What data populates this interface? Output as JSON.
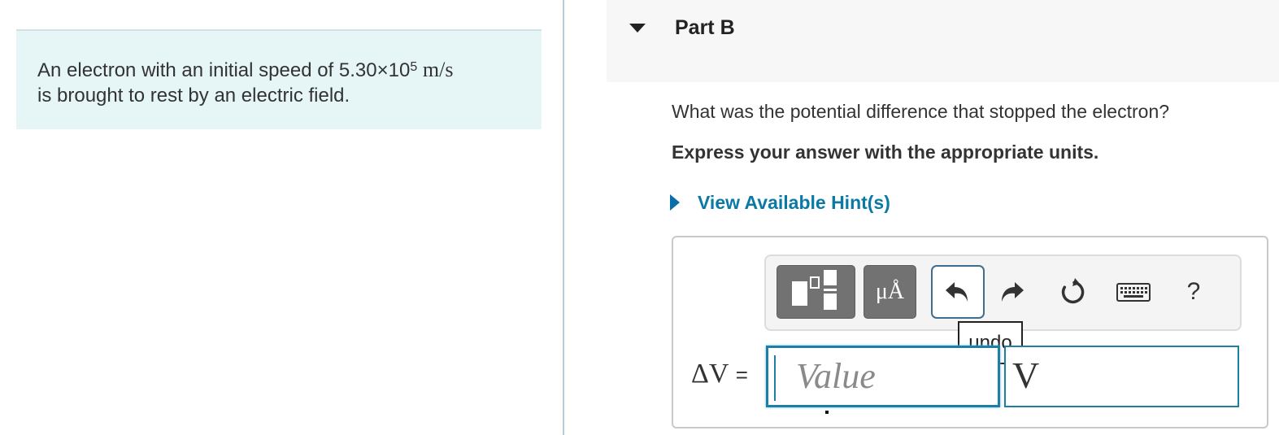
{
  "problem": {
    "text_before": "An electron with an initial speed of 5.30×10",
    "exponent": "5",
    "units": "m/s",
    "text_after": "is brought to rest by an electric field."
  },
  "part": {
    "title": "Part B",
    "question": "What was the potential difference that stopped the electron?",
    "instruction": "Express your answer with the appropriate units.",
    "hint_link": "View Available Hint(s)"
  },
  "toolbar": {
    "units_button_label": "μÅ",
    "help_label": "?",
    "tooltip": "undo"
  },
  "answer": {
    "variable": "ΔV",
    "equals": "=",
    "value_placeholder": "Value",
    "unit_value": "V"
  }
}
